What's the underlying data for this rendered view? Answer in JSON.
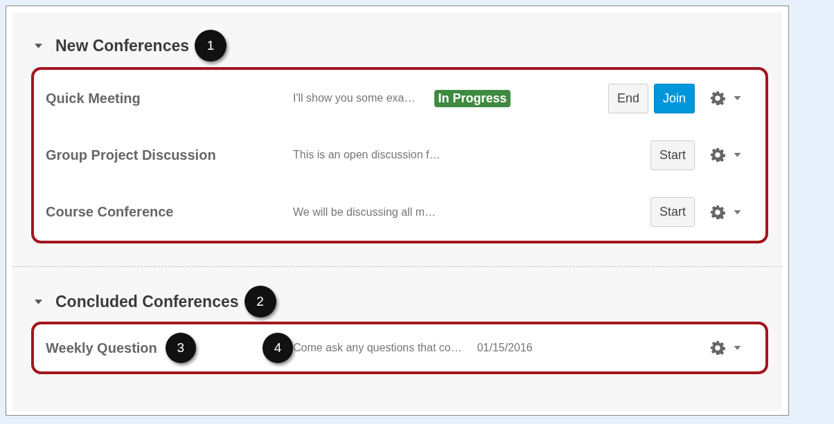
{
  "sections": [
    {
      "title": "New Conferences",
      "expanded": true,
      "callout": "1",
      "rows": [
        {
          "name": "Quick Meeting",
          "description": "I'll show you some exa…",
          "badge": {
            "label": "In Progress",
            "color": "#3f8a41"
          },
          "buttons": [
            {
              "label": "End",
              "kind": "default"
            },
            {
              "label": "Join",
              "kind": "primary"
            }
          ]
        },
        {
          "name": "Group Project Discussion",
          "description": "This is an open discussion f…",
          "buttons": [
            {
              "label": "Start",
              "kind": "default"
            }
          ]
        },
        {
          "name": "Course Conference",
          "description": "We will be discussing all m…",
          "buttons": [
            {
              "label": "Start",
              "kind": "default"
            }
          ]
        }
      ]
    },
    {
      "title": "Concluded Conferences",
      "expanded": true,
      "callout": "2",
      "rows": [
        {
          "name": "Weekly Question",
          "name_callout": "3",
          "description_callout": "4",
          "description": "Come ask any questions that co…",
          "date": "01/15/2016",
          "buttons": []
        }
      ]
    }
  ]
}
